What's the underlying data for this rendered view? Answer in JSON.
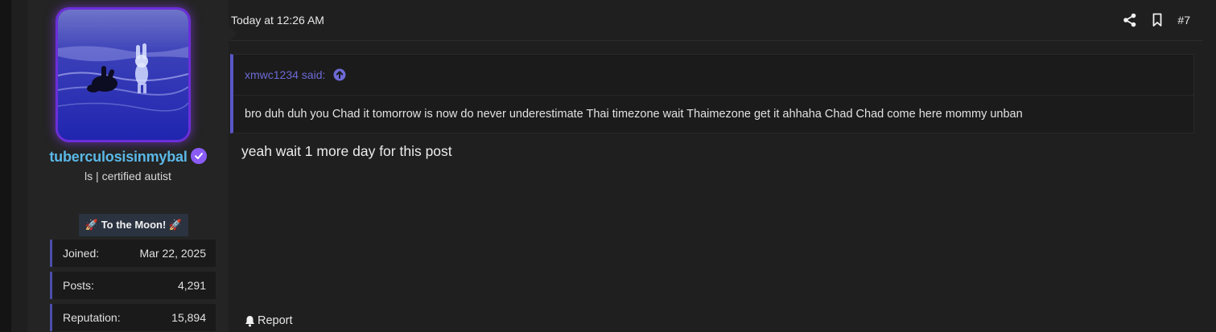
{
  "user": {
    "username": "tuberculosisinmybal",
    "title": "ls | certified autist",
    "banner": "🚀 To the Moon! 🚀",
    "stats": [
      {
        "label": "Joined:",
        "value": "Mar 22, 2025"
      },
      {
        "label": "Posts:",
        "value": "4,291"
      },
      {
        "label": "Reputation:",
        "value": "15,894"
      }
    ]
  },
  "post": {
    "date": "Today at 12:26 AM",
    "number": "#7",
    "quote_author": "xmwc1234 said:",
    "quote_text": "bro duh duh you Chad it tomorrow is now do never underestimate Thai timezone wait Thaimezone get it ahhaha Chad Chad come here mommy unban",
    "body": "yeah wait 1 more day for this post",
    "report_label": "Report"
  },
  "icons": {
    "share": "share-icon",
    "bookmark": "bookmark-icon",
    "quote_jump": "arrow-up-circle-icon",
    "verified": "verified-check-icon",
    "report": "bell-icon"
  },
  "colors": {
    "username": "#5bb8e8",
    "accent": "#5a56c9",
    "avatar_glow": "#6b2fd9",
    "verified": "#8a5cf5"
  }
}
